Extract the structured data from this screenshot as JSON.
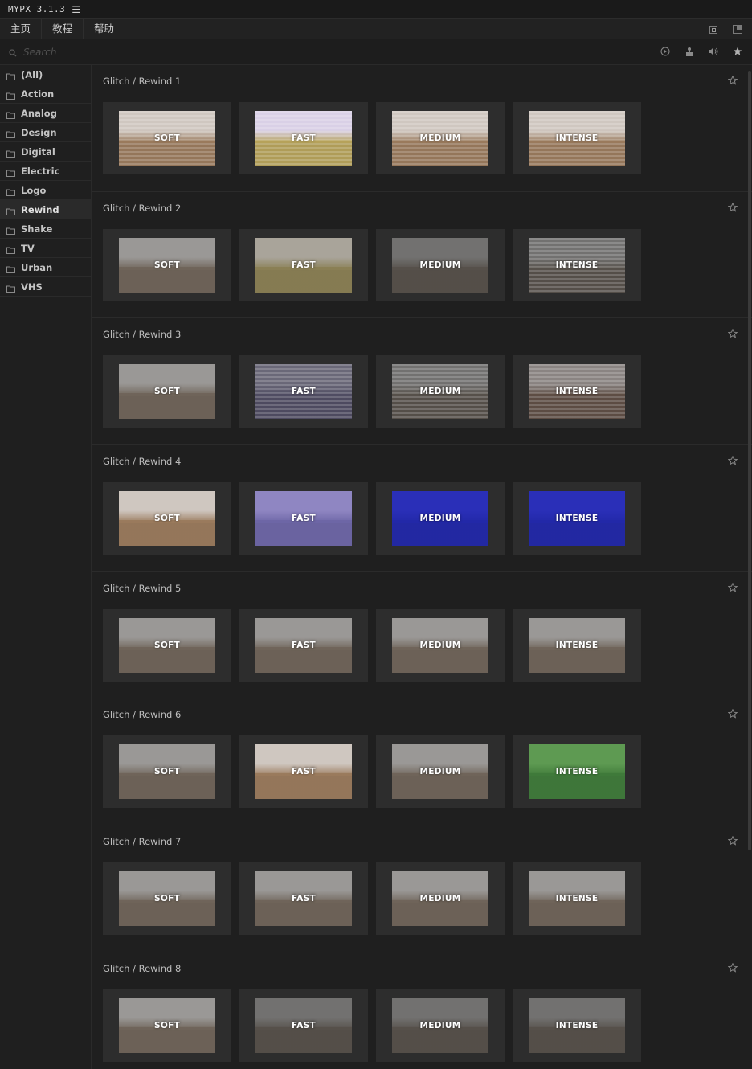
{
  "app": {
    "title": "MYPX 3.1.3"
  },
  "menu": [
    "主页",
    "教程",
    "帮助"
  ],
  "search": {
    "placeholder": "Search"
  },
  "toolbar_icons": [
    "play-circle-icon",
    "stamp-icon",
    "volume-icon",
    "star-filled-icon"
  ],
  "sidebar": {
    "active": "Rewind",
    "items": [
      "(All)",
      "Action",
      "Analog",
      "Design",
      "Digital",
      "Electric",
      "Logo",
      "Rewind",
      "Shake",
      "TV",
      "Urban",
      "VHS"
    ]
  },
  "presets": [
    {
      "title": "Glitch / Rewind 1",
      "cards": [
        {
          "label": "SOFT",
          "tint": "warm",
          "lines": true
        },
        {
          "label": "FAST",
          "tint": "pastel",
          "lines": true
        },
        {
          "label": "MEDIUM",
          "tint": "warm",
          "lines": true
        },
        {
          "label": "INTENSE",
          "tint": "warm",
          "lines": true
        }
      ]
    },
    {
      "title": "Glitch / Rewind 2",
      "cards": [
        {
          "label": "SOFT",
          "tint": "gray"
        },
        {
          "label": "FAST",
          "tint": "olive"
        },
        {
          "label": "MEDIUM",
          "tint": "dark"
        },
        {
          "label": "INTENSE",
          "tint": "dark",
          "lines": true
        }
      ]
    },
    {
      "title": "Glitch / Rewind 3",
      "cards": [
        {
          "label": "SOFT",
          "tint": "gray"
        },
        {
          "label": "FAST",
          "tint": "slate",
          "lines": true
        },
        {
          "label": "MEDIUM",
          "tint": "dark",
          "lines": true
        },
        {
          "label": "INTENSE",
          "tint": "brown",
          "lines": true
        }
      ]
    },
    {
      "title": "Glitch / Rewind 4",
      "cards": [
        {
          "label": "SOFT",
          "tint": "warm"
        },
        {
          "label": "FAST",
          "tint": "purple"
        },
        {
          "label": "MEDIUM",
          "tint": "blue"
        },
        {
          "label": "INTENSE",
          "tint": "blue"
        }
      ]
    },
    {
      "title": "Glitch / Rewind 5",
      "cards": [
        {
          "label": "SOFT",
          "tint": "gray"
        },
        {
          "label": "FAST",
          "tint": "gray"
        },
        {
          "label": "MEDIUM",
          "tint": "gray"
        },
        {
          "label": "INTENSE",
          "tint": "gray"
        }
      ]
    },
    {
      "title": "Glitch / Rewind 6",
      "cards": [
        {
          "label": "SOFT",
          "tint": "gray"
        },
        {
          "label": "FAST",
          "tint": "warm"
        },
        {
          "label": "MEDIUM",
          "tint": "gray"
        },
        {
          "label": "INTENSE",
          "tint": "green"
        }
      ]
    },
    {
      "title": "Glitch / Rewind 7",
      "cards": [
        {
          "label": "SOFT",
          "tint": "gray"
        },
        {
          "label": "FAST",
          "tint": "gray"
        },
        {
          "label": "MEDIUM",
          "tint": "gray"
        },
        {
          "label": "INTENSE",
          "tint": "gray"
        }
      ]
    },
    {
      "title": "Glitch / Rewind 8",
      "cards": [
        {
          "label": "SOFT",
          "tint": "gray"
        },
        {
          "label": "FAST",
          "tint": "dark"
        },
        {
          "label": "MEDIUM",
          "tint": "dark"
        },
        {
          "label": "INTENSE",
          "tint": "dark"
        }
      ]
    }
  ],
  "tints": {
    "warm": {
      "sky": "#cfc7c0",
      "land": "#9a7a5c"
    },
    "pastel": {
      "sky": "#d9d0e6",
      "land": "#b6a25a"
    },
    "gray": {
      "sky": "#9a9896",
      "land": "#6f6459"
    },
    "olive": {
      "sky": "#a9a49a",
      "land": "#8a7f54"
    },
    "dark": {
      "sky": "#727170",
      "land": "#56504a"
    },
    "slate": {
      "sky": "#6a6878",
      "land": "#4f4c62"
    },
    "brown": {
      "sky": "#8a8482",
      "land": "#5e4d44"
    },
    "purple": {
      "sky": "#8f86c2",
      "land": "#6d66a6"
    },
    "blue": {
      "sky": "#2a2fb8",
      "land": "#2228a8"
    },
    "green": {
      "sky": "#5e9a52",
      "land": "#3f7a3a"
    }
  }
}
